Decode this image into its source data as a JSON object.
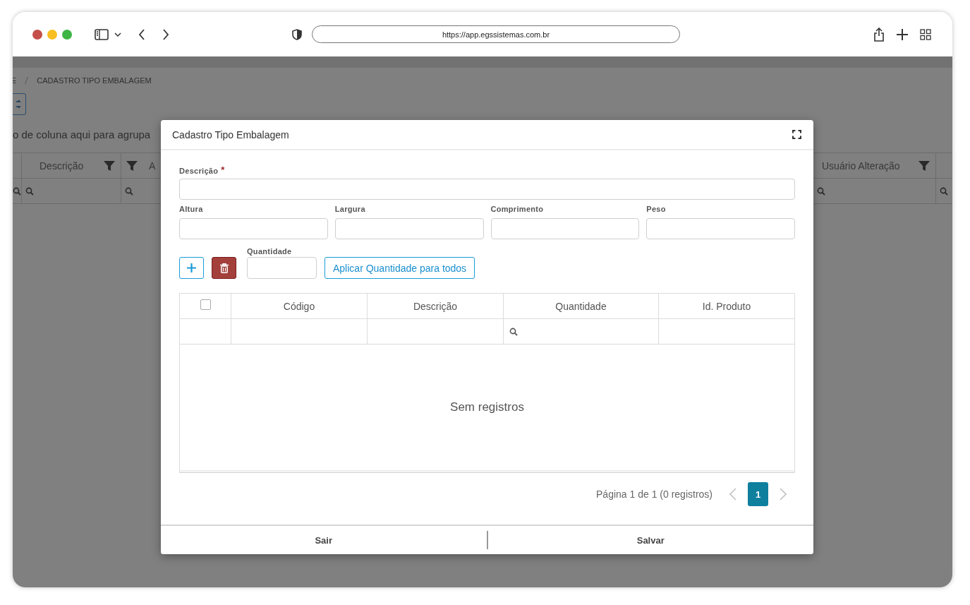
{
  "browser": {
    "url": "https://app.egssistemas.com.br"
  },
  "page": {
    "breadcrumb": [
      "E",
      "CADASTRO TIPO EMBALAGEM"
    ],
    "group_hint": "o de coluna aqui para agrupa",
    "left_columns": [
      {
        "kind": "plain"
      },
      {
        "label": "Descrição",
        "kind": "filter-after"
      },
      {
        "label": "A",
        "kind": "filter-before"
      }
    ],
    "right_columns": [
      {
        "label": "Usuário Alteração",
        "kind": "filter-after"
      },
      {
        "kind": "plain"
      }
    ]
  },
  "modal": {
    "title": "Cadastro Tipo Embalagem",
    "required_mark": "*",
    "description_field": {
      "label": "Descrição",
      "required": true
    },
    "dimension_fields": [
      {
        "label": "Altura",
        "required": false
      },
      {
        "label": "Largura",
        "required": false
      },
      {
        "label": "Comprimento",
        "required": false
      },
      {
        "label": "Peso",
        "required": false
      }
    ],
    "quantity_field": {
      "label": "Quantidade"
    },
    "apply_button": "Aplicar Quantidade para todos",
    "table": {
      "select_all": {
        "checked": false
      },
      "columns": [
        {
          "label": "Código",
          "searchable": false
        },
        {
          "label": "Descrição",
          "searchable": false
        },
        {
          "label": "Quantidade",
          "searchable": true
        },
        {
          "label": "Id. Produto",
          "searchable": false
        }
      ],
      "empty_message": "Sem registros"
    },
    "pager": {
      "summary": "Página 1 de 1 (0 registros)",
      "pages": [
        {
          "label": "1",
          "selected": true
        }
      ]
    },
    "footer_buttons": [
      "Sair",
      "Salvar"
    ]
  }
}
